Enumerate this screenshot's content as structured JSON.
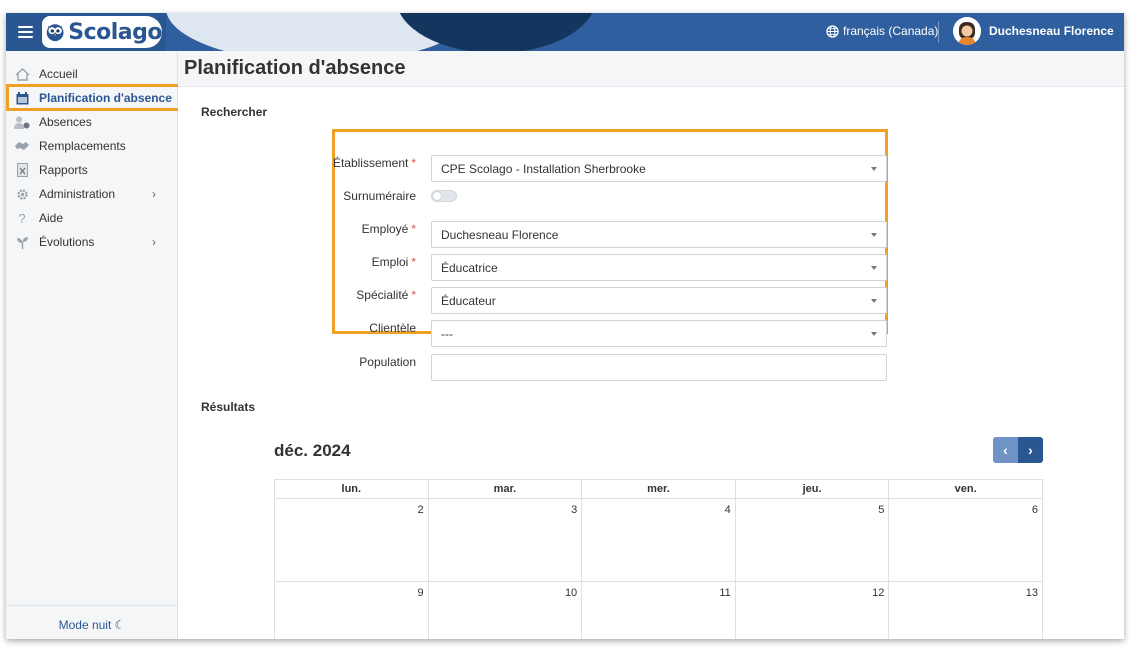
{
  "header": {
    "logo_text": "Scolago",
    "language": "français (Canada)",
    "user_name": "Duchesneau Florence"
  },
  "sidebar": {
    "items": [
      {
        "label": "Accueil",
        "icon": "home-icon"
      },
      {
        "label": "Planification d'absence",
        "icon": "calendar-icon",
        "active": true
      },
      {
        "label": "Absences",
        "icon": "user-absent-icon"
      },
      {
        "label": "Remplacements",
        "icon": "handshake-icon"
      },
      {
        "label": "Rapports",
        "icon": "report-icon"
      },
      {
        "label": "Administration",
        "icon": "gear-icon",
        "has_children": true
      },
      {
        "label": "Aide",
        "icon": "question-icon"
      },
      {
        "label": "Évolutions",
        "icon": "sprout-icon",
        "has_children": true
      }
    ],
    "night_mode_label": "Mode nuit"
  },
  "page": {
    "title": "Planification d'absence",
    "search_section": "Rechercher",
    "results_section": "Résultats"
  },
  "form": {
    "etablissement": {
      "label": "Établissement",
      "value": "CPE Scolago - Installation Sherbrooke",
      "required": true
    },
    "surnumeraire": {
      "label": "Surnuméraire",
      "value": false
    },
    "employe": {
      "label": "Employé",
      "value": "Duchesneau Florence",
      "required": true
    },
    "emploi": {
      "label": "Emploi",
      "value": "Éducatrice",
      "required": true
    },
    "specialite": {
      "label": "Spécialité",
      "value": "Éducateur",
      "required": true
    },
    "clientele": {
      "label": "Clientèle",
      "value": "---"
    },
    "population": {
      "label": "Population",
      "value": ""
    },
    "required_mark": "*"
  },
  "calendar": {
    "month_label": "déc. 2024",
    "weekdays": [
      "lun.",
      "mar.",
      "mer.",
      "jeu.",
      "ven."
    ],
    "weeks": [
      [
        "2",
        "3",
        "4",
        "5",
        "6"
      ],
      [
        "9",
        "10",
        "11",
        "12",
        "13"
      ]
    ]
  },
  "colors": {
    "primary": "#2a5791",
    "highlight": "#f0a024",
    "required": "#d9534f"
  }
}
